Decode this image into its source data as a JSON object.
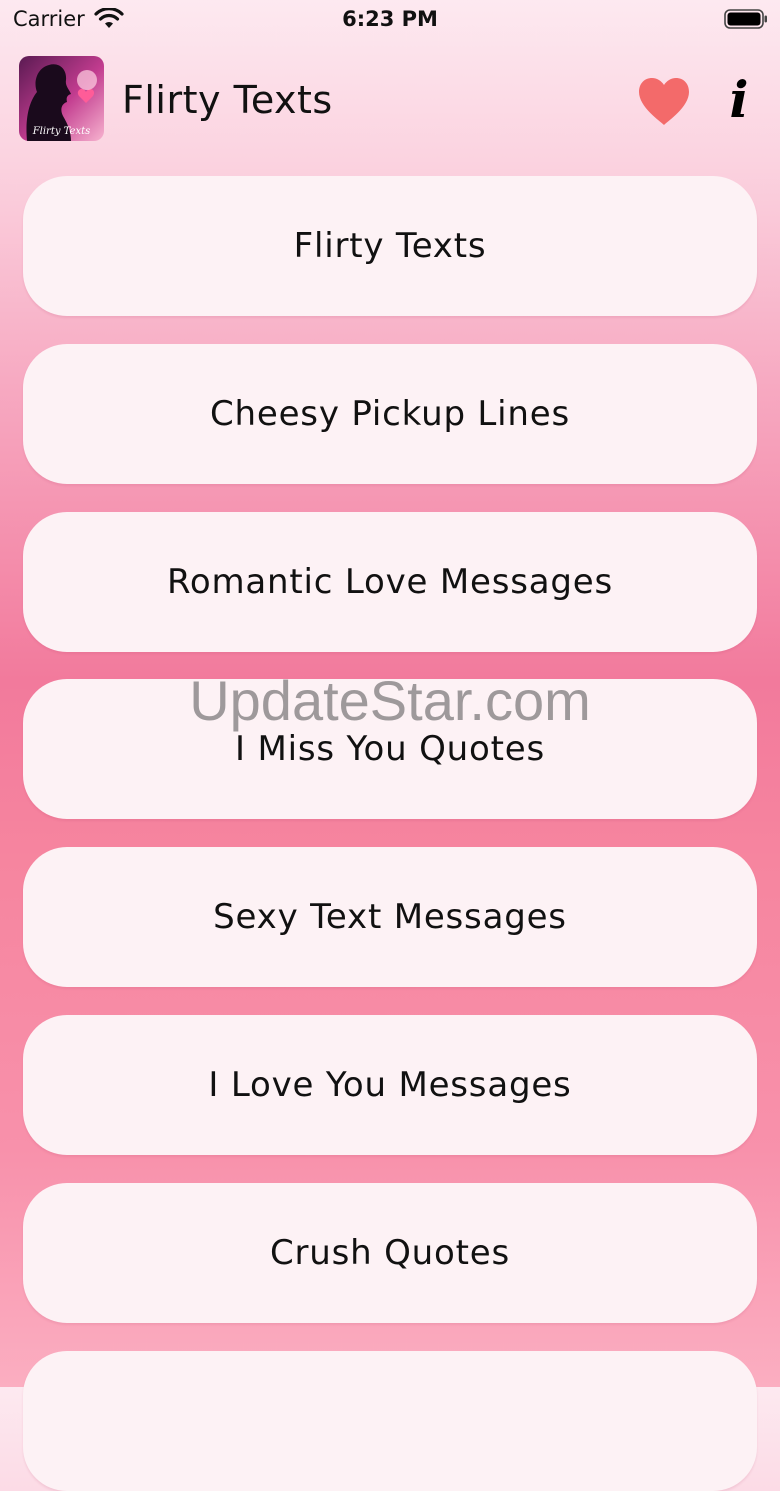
{
  "status_bar": {
    "carrier": "Carrier",
    "time": "6:23 PM"
  },
  "header": {
    "logo_text": "Flirty Texts",
    "title": "Flirty Texts",
    "favorites_icon": "heart-icon",
    "info_icon": "info-icon",
    "info_glyph": "i"
  },
  "categories": [
    {
      "label": "Flirty Texts"
    },
    {
      "label": "Cheesy Pickup Lines"
    },
    {
      "label": "Romantic Love Messages"
    },
    {
      "label": "I Miss You Quotes"
    },
    {
      "label": "Sexy Text Messages"
    },
    {
      "label": "I Love You Messages"
    },
    {
      "label": "Crush Quotes"
    },
    {
      "label": ""
    }
  ],
  "watermark": "UpdateStar.com",
  "colors": {
    "heart": "#f36a6a",
    "card": "#fdf2f5",
    "accent_pink": "#f27a9c"
  }
}
